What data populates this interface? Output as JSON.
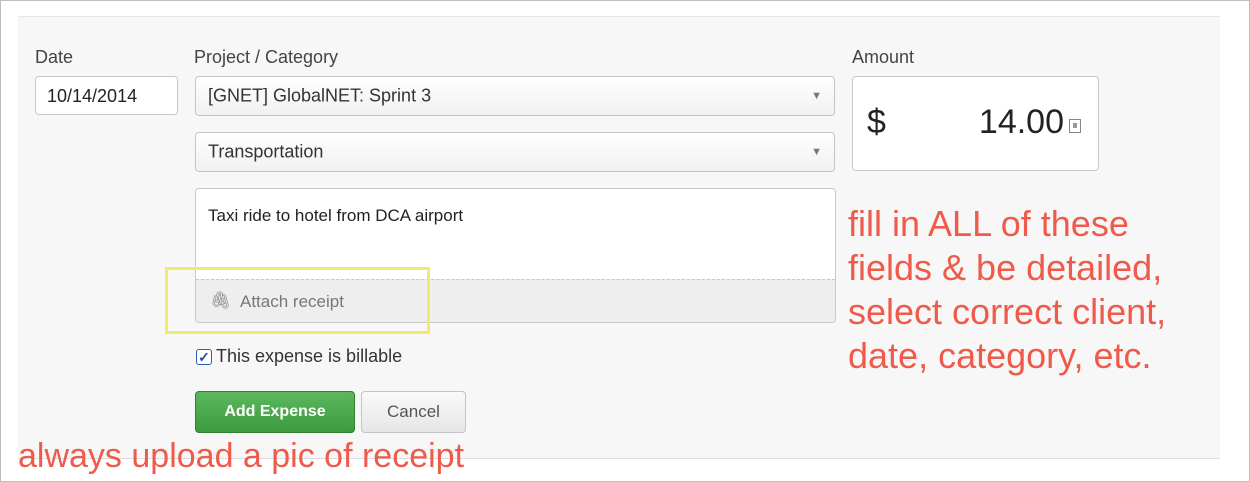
{
  "labels": {
    "date": "Date",
    "project_category": "Project / Category",
    "amount": "Amount"
  },
  "fields": {
    "date_value": "10/14/2014",
    "project_value": "[GNET] GlobalNET: Sprint 3",
    "category_value": "Transportation",
    "notes_value": "Taxi ride to hotel from DCA airport",
    "attach_label": "Attach receipt",
    "currency_symbol": "$",
    "amount_value": "14.00"
  },
  "billable": {
    "checked": true,
    "label": "This expense is billable"
  },
  "buttons": {
    "add_label": "Add Expense",
    "cancel_label": "Cancel"
  },
  "annotations": {
    "right_lines": [
      "fill in ALL of these",
      "fields & be detailed,",
      "select correct client,",
      "date, category, etc."
    ],
    "bottom": "always upload a pic of receipt",
    "color": "#ef5a4a"
  },
  "icons": {
    "select_caret": "caret-down-icon",
    "attach": "paperclip-icon",
    "checkbox": "checkmark-icon",
    "amount_widget": "calculator-icon"
  }
}
